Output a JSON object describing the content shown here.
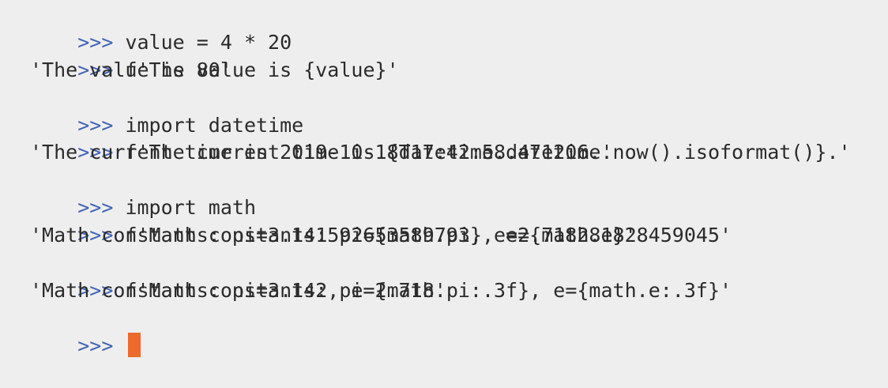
{
  "terminal": {
    "prompt": ">>>",
    "colors": {
      "background": "#eeeeee",
      "text": "#2b2b2b",
      "prompt": "#3f63b8",
      "cursor": "#ec6a2c"
    },
    "lines": [
      {
        "type": "input",
        "text": "value = 4 * 20"
      },
      {
        "type": "input",
        "text": "f'The value is {value}'"
      },
      {
        "type": "output",
        "text": "'The value is 80'"
      },
      {
        "type": "input",
        "text": "import datetime"
      },
      {
        "type": "input",
        "text": "f'The current time is {datetime.datetime.now().isoformat()}.'"
      },
      {
        "type": "output",
        "text": "'The current time is 2019-10-18T17:42:58.471206.'"
      },
      {
        "type": "input",
        "text": "import math"
      },
      {
        "type": "input",
        "text": "f'Math constants: pi={math.pi}, e={math.e}'"
      },
      {
        "type": "output",
        "text": "'Math constants: pi=3.141592653589793, e=2.718281828459045'"
      },
      {
        "type": "input",
        "text": "f'Math constants: pi={math.pi:.3f}, e={math.e:.3f}'"
      },
      {
        "type": "output",
        "text": "'Math constants: pi=3.142, e=2.718'"
      }
    ],
    "cursor_line": {
      "type": "prompt",
      "text": ""
    }
  }
}
